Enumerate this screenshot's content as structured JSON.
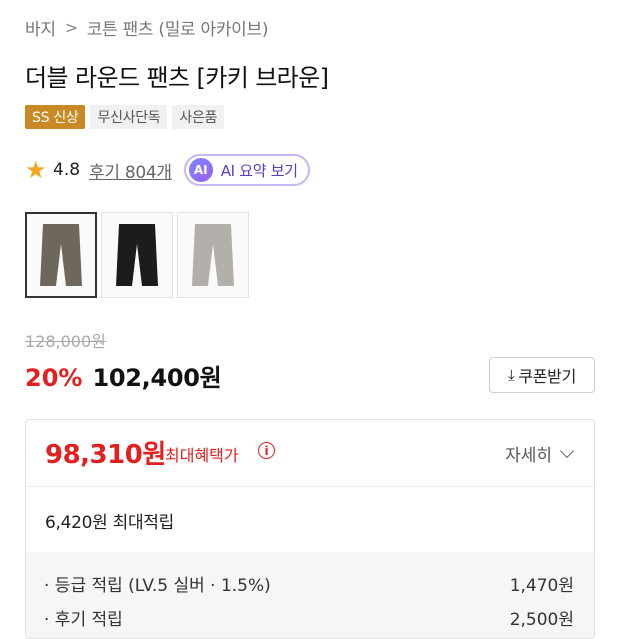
{
  "breadcrumb": {
    "items": [
      "바지",
      "코튼 팬츠 (밀로 아카이브)"
    ]
  },
  "product": {
    "title": "더블 라운드 팬츠 [카키 브라운]"
  },
  "badges": [
    "SS 신상",
    "무신사단독",
    "사은품"
  ],
  "rating": {
    "value": "4.8",
    "review_text": "후기 804개"
  },
  "ai_summary": {
    "icon_text": "AI",
    "label": "AI 요약 보기"
  },
  "thumbnails": [
    {
      "color_name": "khaki-brown",
      "color": "#6e675c",
      "selected": true
    },
    {
      "color_name": "black",
      "color": "#1c1c1c",
      "selected": false
    },
    {
      "color_name": "gray",
      "color": "#b3b0ab",
      "selected": false
    }
  ],
  "price": {
    "original": "128,000원",
    "discount": "20%",
    "sale": "102,400원",
    "coupon_label": "쿠폰받기"
  },
  "max_benefit": {
    "price": "98,310원",
    "label": "최대혜택가",
    "detail_label": "자세히",
    "points_summary": "6,420원 최대적립",
    "rows": [
      {
        "label": "· 등급 적립 (LV.5 실버 · 1.5%)",
        "value": "1,470원"
      },
      {
        "label": "· 후기 적립",
        "value": "2,500원"
      }
    ]
  },
  "colors": {
    "accent_red": "#e32020",
    "badge_gold": "#c98a26",
    "ai_purple": "#5a3dc8"
  }
}
